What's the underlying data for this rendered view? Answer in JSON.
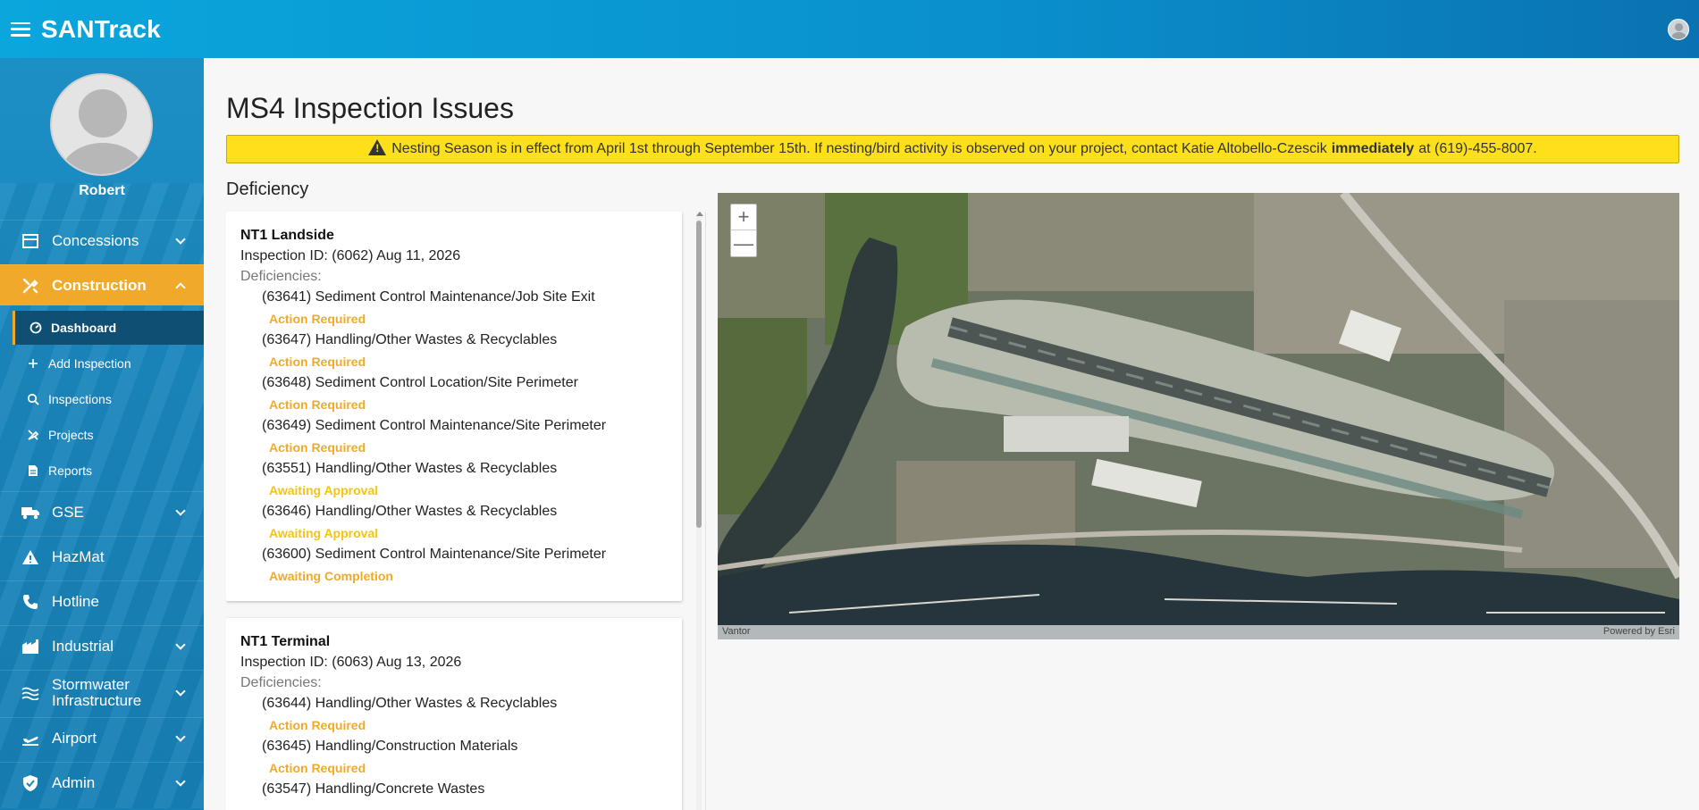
{
  "header": {
    "title": "SANTrack"
  },
  "sidebar": {
    "username": "Robert",
    "items": [
      {
        "label": "Concessions",
        "icon": "store-icon"
      },
      {
        "label": "Construction",
        "icon": "tools-icon"
      },
      {
        "label": "GSE",
        "icon": "truck-icon"
      },
      {
        "label": "HazMat",
        "icon": "warning-icon"
      },
      {
        "label": "Hotline",
        "icon": "phone-icon"
      },
      {
        "label": "Industrial",
        "icon": "industry-icon"
      },
      {
        "label": "Stormwater Infrastructure",
        "icon": "water-icon"
      },
      {
        "label": "Airport",
        "icon": "plane-icon"
      },
      {
        "label": "Admin",
        "icon": "shield-icon"
      }
    ],
    "construction_sub": [
      {
        "label": "Dashboard",
        "icon": "gauge-icon"
      },
      {
        "label": "Add Inspection",
        "icon": "plus-icon"
      },
      {
        "label": "Inspections",
        "icon": "search-icon"
      },
      {
        "label": "Projects",
        "icon": "tools-icon"
      },
      {
        "label": "Reports",
        "icon": "document-icon"
      }
    ]
  },
  "main": {
    "title": "MS4 Inspection Issues",
    "alert": {
      "before": "Nesting Season is in effect from April 1st through September 15th. If nesting/bird activity is observed on your project, contact Katie Altobello-Czescik",
      "bold": "immediately",
      "after": "at (619)-455-8007."
    },
    "section_title": "Deficiency",
    "cards": [
      {
        "title": "NT1 Landside",
        "inspection": "Inspection ID: (6062) Aug 11, 2026",
        "deficiencies_label": "Deficiencies:",
        "items": [
          {
            "label": "(63641) Sediment Control Maintenance/Job Site Exit",
            "status": "Action Required"
          },
          {
            "label": "(63647) Handling/Other Wastes & Recyclables",
            "status": "Action Required"
          },
          {
            "label": "(63648) Sediment Control Location/Site Perimeter",
            "status": "Action Required"
          },
          {
            "label": "(63649) Sediment Control Maintenance/Site Perimeter",
            "status": "Action Required"
          },
          {
            "label": "(63551) Handling/Other Wastes & Recyclables",
            "status": "Awaiting Approval"
          },
          {
            "label": "(63646) Handling/Other Wastes & Recyclables",
            "status": "Awaiting Approval"
          },
          {
            "label": "(63600) Sediment Control Maintenance/Site Perimeter",
            "status": "Awaiting Completion"
          }
        ]
      },
      {
        "title": "NT1 Terminal",
        "inspection": "Inspection ID: (6063) Aug 13, 2026",
        "deficiencies_label": "Deficiencies:",
        "items": [
          {
            "label": "(63644) Handling/Other Wastes & Recyclables",
            "status": "Action Required"
          },
          {
            "label": "(63645) Handling/Construction Materials",
            "status": "Action Required"
          },
          {
            "label": "(63547) Handling/Concrete Wastes",
            "status": ""
          }
        ]
      }
    ],
    "map": {
      "zoom_in": "+",
      "zoom_out": "—",
      "attribution_left": "Vantor",
      "attribution_right": "Powered by Esri"
    }
  },
  "colors": {
    "brand_blue": "#0a8fcc",
    "active_orange": "#f0a92b",
    "alert_yellow": "#fde01a",
    "approval_yellow": "#f2c511"
  }
}
